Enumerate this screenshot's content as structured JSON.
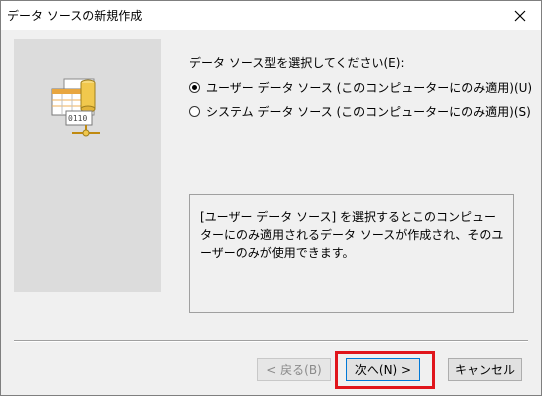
{
  "window": {
    "title": "データ ソースの新規作成",
    "close_icon": "close-icon"
  },
  "main": {
    "prompt": "データ ソース型を選択してください(E):",
    "options": [
      {
        "label": "ユーザー データ ソース (このコンピューターにのみ適用)(U)",
        "selected": true
      },
      {
        "label": "システム データ ソース (このコンピューターにのみ適用)(S)",
        "selected": false
      }
    ],
    "description": "[ユーザー データ ソース] を選択するとこのコンピューターにのみ適用されるデータ ソースが作成され、そのユーザーのみが使用できます。"
  },
  "buttons": {
    "back": "< 戻る(B)",
    "next": "次へ(N) >",
    "cancel": "キャンセル"
  },
  "colors": {
    "highlight": "#e0151b",
    "illustration_bg": "#dcdcdc"
  }
}
